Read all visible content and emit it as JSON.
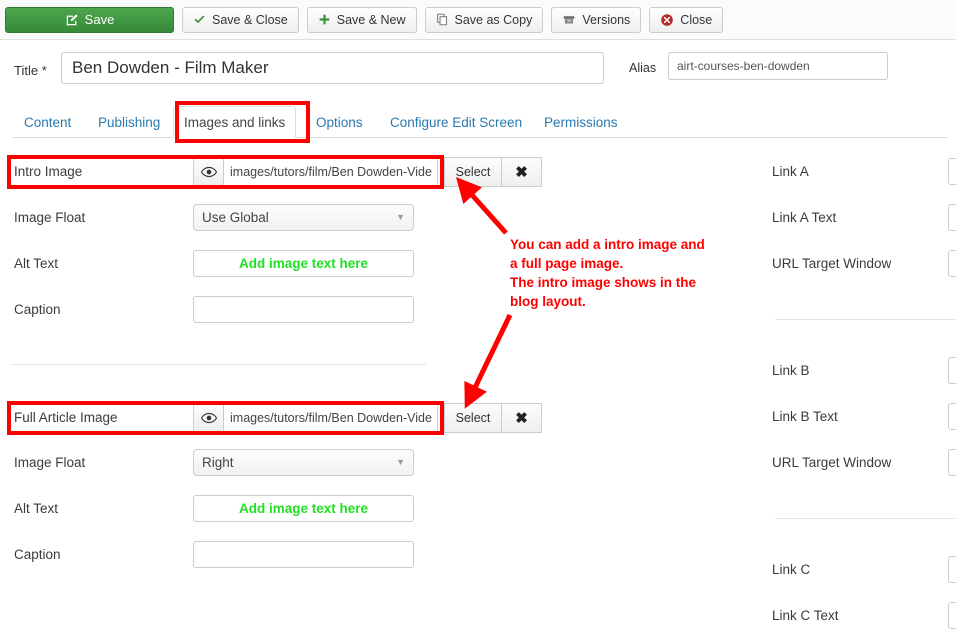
{
  "toolbar": {
    "buttons": [
      {
        "label": "Save",
        "icon": "pencil-square-icon",
        "style": "primary"
      },
      {
        "label": "Save & Close",
        "icon": "check-icon",
        "style": "default"
      },
      {
        "label": "Save & New",
        "icon": "plus-icon",
        "style": "default"
      },
      {
        "label": "Save as Copy",
        "icon": "copy-icon",
        "style": "default"
      },
      {
        "label": "Versions",
        "icon": "archive-icon",
        "style": "default"
      },
      {
        "label": "Close",
        "icon": "close-circle-icon",
        "style": "default"
      }
    ]
  },
  "titleRow": {
    "title_label": "Title *",
    "title_value": "Ben Dowden - Film Maker",
    "alias_label": "Alias",
    "alias_value": "airt-courses-ben-dowden"
  },
  "tabs": [
    {
      "label": "Content",
      "active": false
    },
    {
      "label": "Publishing",
      "active": false
    },
    {
      "label": "Images and links",
      "active": true
    },
    {
      "label": "Options",
      "active": false
    },
    {
      "label": "Configure Edit Screen",
      "active": false
    },
    {
      "label": "Permissions",
      "active": false
    }
  ],
  "left_column": {
    "intro": {
      "media_label": "Intro Image",
      "media_path": "images/tutors/film/Ben Dowden-Vide",
      "select_label": "Select",
      "clear_label": "✖",
      "float_label": "Image Float",
      "float_value": "Use Global",
      "alt_label": "Alt Text",
      "alt_value": "Add image text here",
      "caption_label": "Caption",
      "caption_value": ""
    },
    "full": {
      "media_label": "Full Article Image",
      "media_path": "images/tutors/film/Ben Dowden-Vide",
      "select_label": "Select",
      "clear_label": "✖",
      "float_label": "Image Float",
      "float_value": "Right",
      "alt_label": "Alt Text",
      "alt_value": "Add image text here",
      "caption_label": "Caption",
      "caption_value": ""
    }
  },
  "right_column": {
    "group_a": [
      {
        "label": "Link A",
        "value": ""
      },
      {
        "label": "Link A Text",
        "value": ""
      },
      {
        "label": "URL Target Window",
        "value": ""
      }
    ],
    "group_b": [
      {
        "label": "Link B",
        "value": ""
      },
      {
        "label": "Link B Text",
        "value": ""
      },
      {
        "label": "URL Target Window",
        "value": ""
      }
    ],
    "group_c": [
      {
        "label": "Link C",
        "value": ""
      },
      {
        "label": "Link C Text",
        "value": ""
      }
    ]
  },
  "annotation": {
    "line1": "You can add a intro image and",
    "line2": "a full page image.",
    "line3": "The intro image shows in the",
    "line4": "blog layout.",
    "color": "#ff0000"
  },
  "colors": {
    "primary_green": "#3f9142",
    "accent_red": "#ff0000",
    "link_blue": "#2a7ab0",
    "alt_text_green": "#22e022",
    "close_red": "#b02b2b"
  }
}
